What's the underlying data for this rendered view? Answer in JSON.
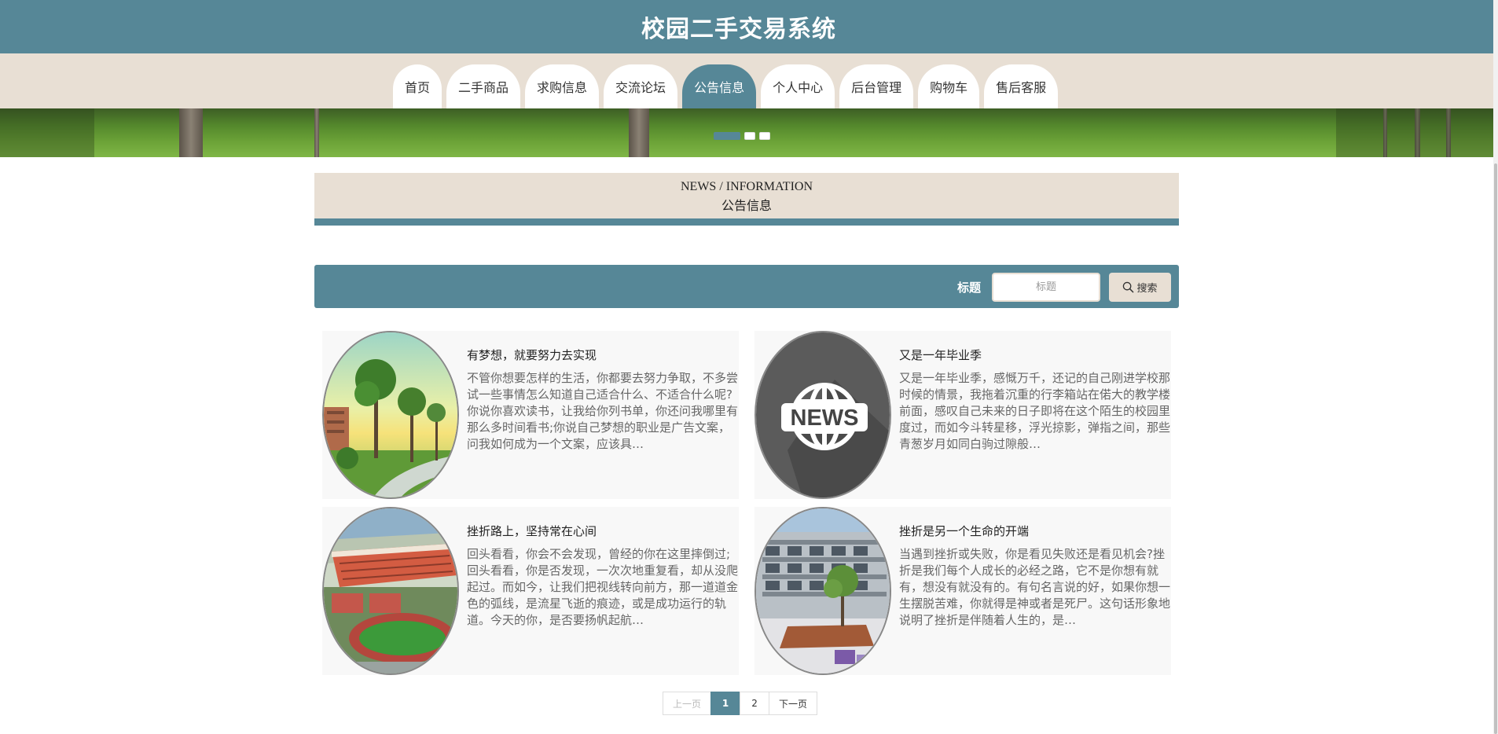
{
  "site": {
    "title": "校园二手交易系统"
  },
  "nav": {
    "items": [
      "首页",
      "二手商品",
      "求购信息",
      "交流论坛",
      "公告信息",
      "个人中心",
      "后台管理",
      "购物车",
      "售后客服"
    ],
    "active_index": 4
  },
  "banner": {
    "slide_count": 3,
    "active_slide": 1
  },
  "section": {
    "en_title": "NEWS / INFORMATION",
    "cn_title": "公告信息"
  },
  "search": {
    "label": "标题",
    "placeholder": "标题",
    "value": "",
    "button_label": "搜索",
    "icon": "search-icon"
  },
  "news": [
    {
      "title": "有梦想，就要努力去实现",
      "desc": "不管你想要怎样的生活，你都要去努力争取，不多尝试一些事情怎么知道自己适合什么、不适合什么呢?你说你喜欢读书，让我给你列书单，你还问我哪里有那么多时间看书;你说自己梦想的职业是广告文案，问我如何成为一个文案，应该具…",
      "image": "campus-trees"
    },
    {
      "title": "又是一年毕业季",
      "desc": "又是一年毕业季，感慨万千，还记的自己刚进学校那时候的情景，我拖着沉重的行李箱站在偌大的教学楼前面，感叹自己未来的日子即将在这个陌生的校园里度过，而如今斗转星移，浮光掠影，弹指之间，那些青葱岁月如同白驹过隙般…",
      "image": "news-globe",
      "image_text": "NEWS"
    },
    {
      "title": "挫折路上，坚持常在心间",
      "desc": "回头看看，你会不会发现，曾经的你在这里摔倒过;回头看看，你是否发现，一次次地重复看，却从没爬起过。而如今，让我们把视线转向前方，那一道道金色的弧线，是流星飞逝的痕迹，或是成功运行的轨道。今天的你，是否要扬帆起航…",
      "image": "campus-aerial"
    },
    {
      "title": "挫折是另一个生命的开端",
      "desc": "当遇到挫折或失败，你是看见失败还是看见机会?挫折是我们每个人成长的必经之路，它不是你想有就有，想没有就没有的。有句名言说的好，如果你想一生摆脱苦难，你就得是神或者是死尸。这句话形象地说明了挫折是伴随着人生的，是…",
      "image": "campus-courtyard"
    }
  ],
  "pagination": {
    "prev_label": "上一页",
    "next_label": "下一页",
    "pages": [
      "1",
      "2"
    ],
    "current": "1"
  },
  "colors": {
    "primary": "#568797",
    "beige": "#e8dfd4",
    "card_bg": "#f8f8f8"
  }
}
